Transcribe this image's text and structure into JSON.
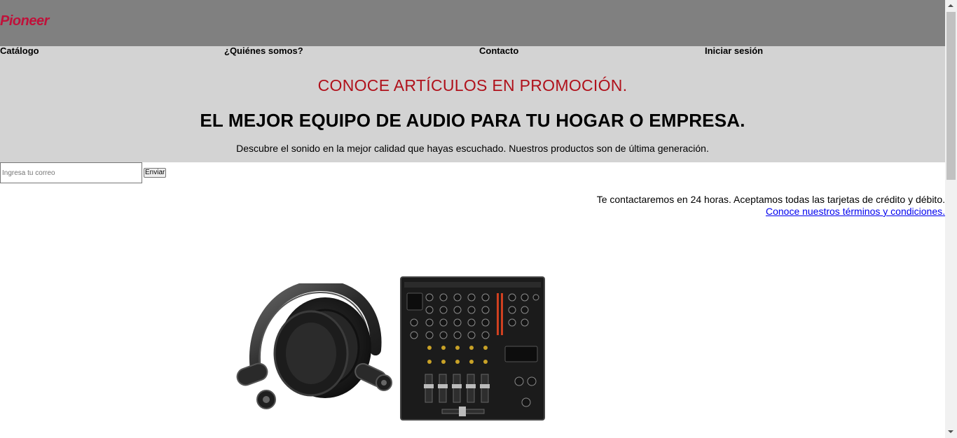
{
  "header": {
    "logo_text": "Pioneer"
  },
  "nav": {
    "items": [
      {
        "label": "Catálogo"
      },
      {
        "label": "¿Quiénes somos?"
      },
      {
        "label": "Contacto"
      },
      {
        "label": "Iniciar sesión"
      }
    ]
  },
  "hero": {
    "promo": "CONOCE ARTÍCULOS EN PROMOCIÓN.",
    "headline": "EL MEJOR EQUIPO DE AUDIO PARA TU HOGAR O EMPRESA.",
    "subtext": "Descubre el sonido en la mejor calidad que hayas escuchado. Nuestros productos son de última generación."
  },
  "form": {
    "email_placeholder": "Ingresa tu correo",
    "email_value": "",
    "submit_label": "Enviar"
  },
  "info": {
    "text": "Te contactaremos en 24 horas. Aceptamos todas las tarjetas de crédito y débito.",
    "terms_link": "Conoce nuestros términos y condiciones."
  },
  "colors": {
    "header_bg": "#808080",
    "band_bg": "#d3d3d3",
    "brand": "#c0113a",
    "promo": "#b0111b",
    "link": "#0000ee"
  },
  "images": [
    "headphones-product-image",
    "dj-mixer-product-image"
  ]
}
